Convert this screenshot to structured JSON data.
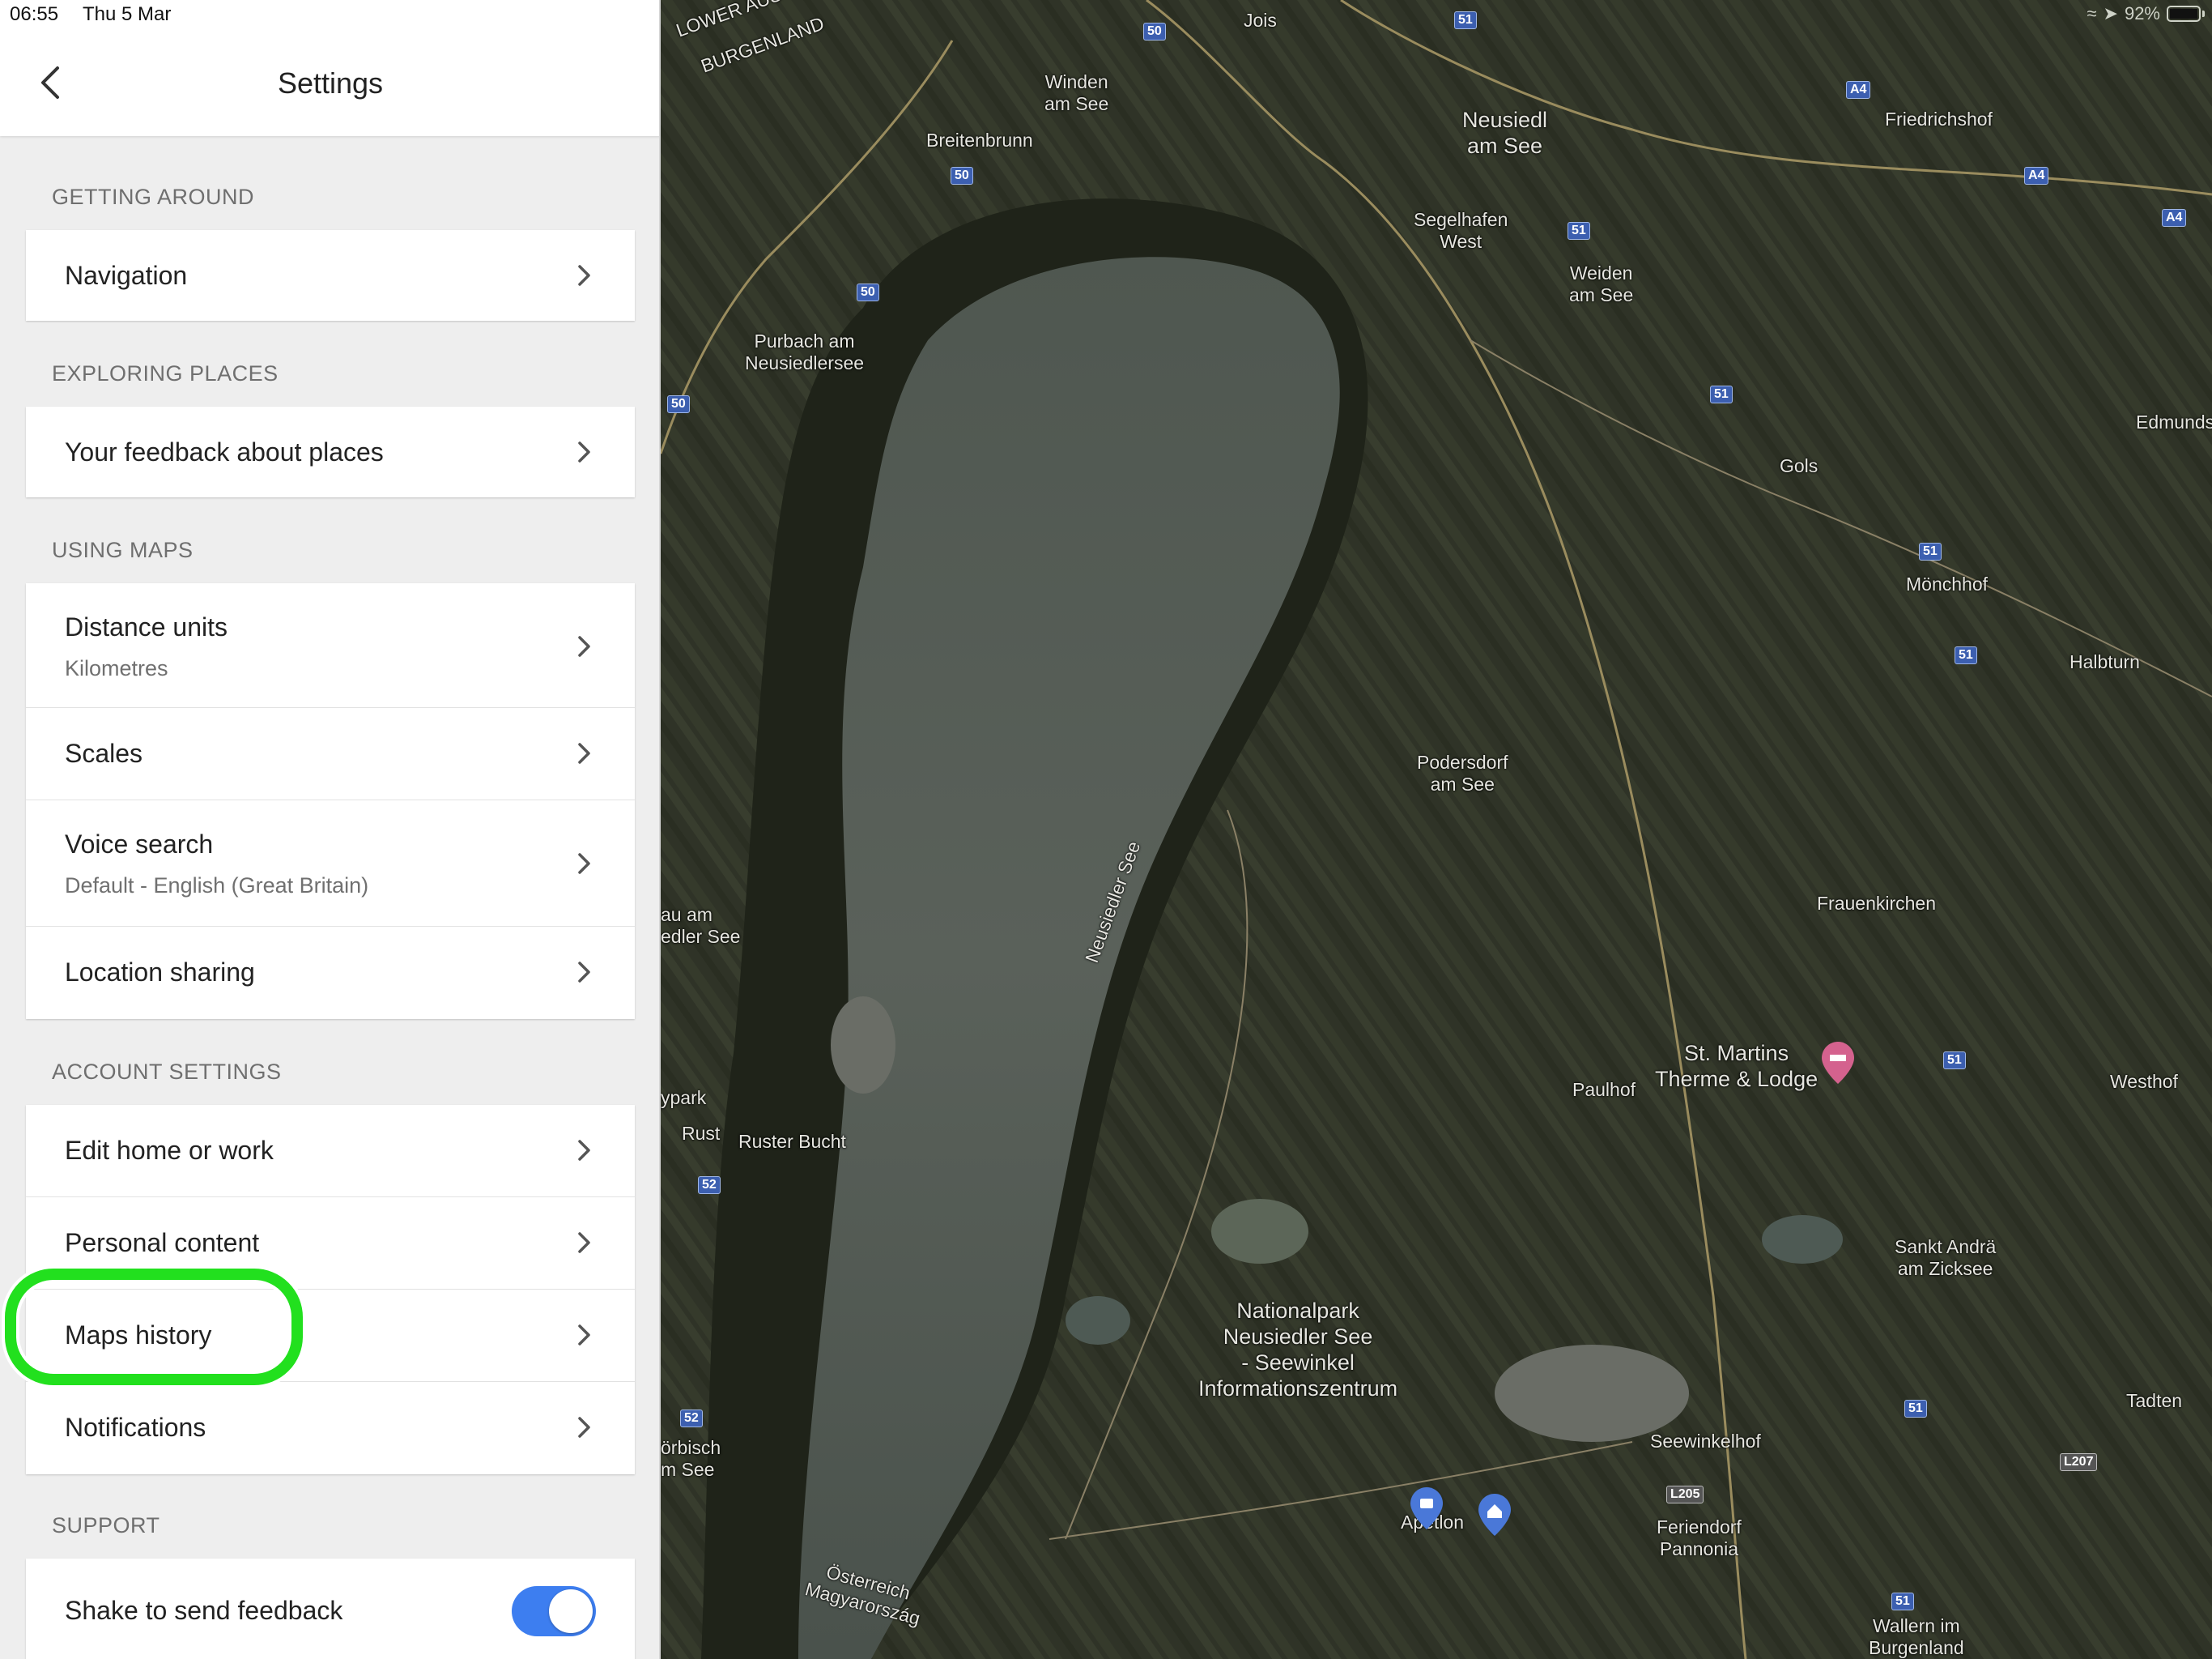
{
  "status_bar": {
    "time": "06:55",
    "date": "Thu 5 Mar",
    "battery": "92%"
  },
  "header": {
    "title": "Settings"
  },
  "sections": {
    "getting_around": {
      "label": "GETTING AROUND",
      "navigation": "Navigation"
    },
    "exploring_places": {
      "label": "EXPLORING PLACES",
      "feedback": "Your feedback about places"
    },
    "using_maps": {
      "label": "USING MAPS",
      "distance_units": "Distance units",
      "distance_units_value": "Kilometres",
      "scales": "Scales",
      "voice_search": "Voice search",
      "voice_search_value": "Default - English (Great Britain)",
      "location_sharing": "Location sharing"
    },
    "account_settings": {
      "label": "ACCOUNT SETTINGS",
      "edit_home_work": "Edit home or work",
      "personal_content": "Personal content",
      "maps_history": "Maps history",
      "notifications": "Notifications"
    },
    "support": {
      "label": "SUPPORT",
      "shake_feedback": "Shake to send feedback",
      "shake_feedback_enabled": true
    }
  },
  "map": {
    "labels": {
      "lower_austria": "LOWER AUS",
      "burgenland": "BURGENLAND",
      "jois": "Jois",
      "winden": "Winden\nam See",
      "breitenbrunn": "Breitenbrunn",
      "neusiedl": "Neusiedl\nam See",
      "friedrichshof": "Friedrichshof",
      "segelhafen": "Segelhafen\nWest",
      "weiden": "Weiden\nam See",
      "purbach": "Purbach am\nNeusiedlersee",
      "edmunds": "Edmunds",
      "gols": "Gols",
      "monchhof": "Mönchhof",
      "halbturn": "Halbturn",
      "podersdorf": "Podersdorf\nam See",
      "frauenkirchen": "Frauenkirchen",
      "lake": "Neusiedler See",
      "rust_am": "au am\nedler See",
      "st_martins": "St. Martins\nTherme & Lodge",
      "paulhof": "Paulhof",
      "westhof": "Westhof",
      "ypark": "ypark",
      "rust": "Rust",
      "ruster_bucht": "Ruster Bucht",
      "sankt_andra": "Sankt Andrä\nam Zicksee",
      "nationalpark": "Nationalpark\nNeusiedler See\n- Seewinkel\nInformationszentrum",
      "tadten": "Tadten",
      "orbisch": "örbisch\nm See",
      "seewinkelhof": "Seewinkelhof",
      "apetlon": "Apetlon",
      "feriendorf": "Feriendorf\nPannonia",
      "osterreich": "Österreich\nMagyarország",
      "wallern": "Wallern im\nBurgenland"
    },
    "shields": [
      "50",
      "51",
      "A4",
      "52",
      "L205",
      "L207"
    ]
  }
}
